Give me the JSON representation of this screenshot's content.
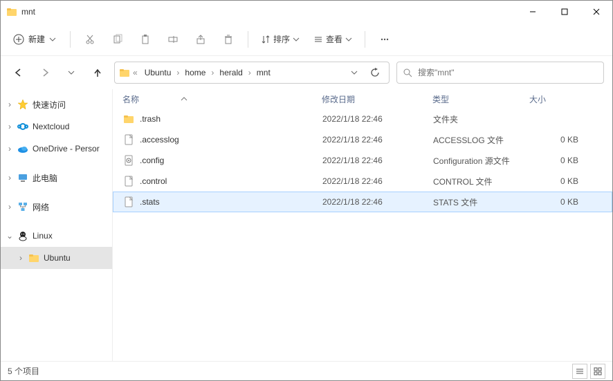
{
  "window": {
    "title": "mnt"
  },
  "toolbar": {
    "new_label": "新建",
    "sort_label": "排序",
    "view_label": "查看"
  },
  "breadcrumbs": {
    "pre": "«",
    "items": [
      "Ubuntu",
      "home",
      "herald",
      "mnt"
    ]
  },
  "search": {
    "placeholder": "搜索\"mnt\""
  },
  "sidebar": [
    {
      "label": "快速访问",
      "icon": "star",
      "expandable": true,
      "level": 0
    },
    {
      "label": "Nextcloud",
      "icon": "nextcloud",
      "expandable": true,
      "level": 0
    },
    {
      "label": "OneDrive - Persor",
      "icon": "onedrive",
      "expandable": true,
      "level": 0
    },
    {
      "label": "此电脑",
      "icon": "pc",
      "expandable": true,
      "level": 0,
      "gapBefore": true
    },
    {
      "label": "网络",
      "icon": "network",
      "expandable": true,
      "level": 0,
      "gapBefore": true
    },
    {
      "label": "Linux",
      "icon": "linux",
      "expandable": true,
      "expanded": true,
      "level": 0,
      "gapBefore": true
    },
    {
      "label": "Ubuntu",
      "icon": "folder",
      "expandable": true,
      "level": 1,
      "selected": true
    }
  ],
  "columns": {
    "name": "名称",
    "modified": "修改日期",
    "type": "类型",
    "size": "大小"
  },
  "files": [
    {
      "name": ".trash",
      "modified": "2022/1/18 22:46",
      "type": "文件夹",
      "size": "",
      "icon": "folder"
    },
    {
      "name": ".accesslog",
      "modified": "2022/1/18 22:46",
      "type": "ACCESSLOG 文件",
      "size": "0 KB",
      "icon": "file"
    },
    {
      "name": ".config",
      "modified": "2022/1/18 22:46",
      "type": "Configuration 源文件",
      "size": "0 KB",
      "icon": "config"
    },
    {
      "name": ".control",
      "modified": "2022/1/18 22:46",
      "type": "CONTROL 文件",
      "size": "0 KB",
      "icon": "file"
    },
    {
      "name": ".stats",
      "modified": "2022/1/18 22:46",
      "type": "STATS 文件",
      "size": "0 KB",
      "icon": "file",
      "selected": true
    }
  ],
  "status": {
    "text": "5 个项目"
  }
}
